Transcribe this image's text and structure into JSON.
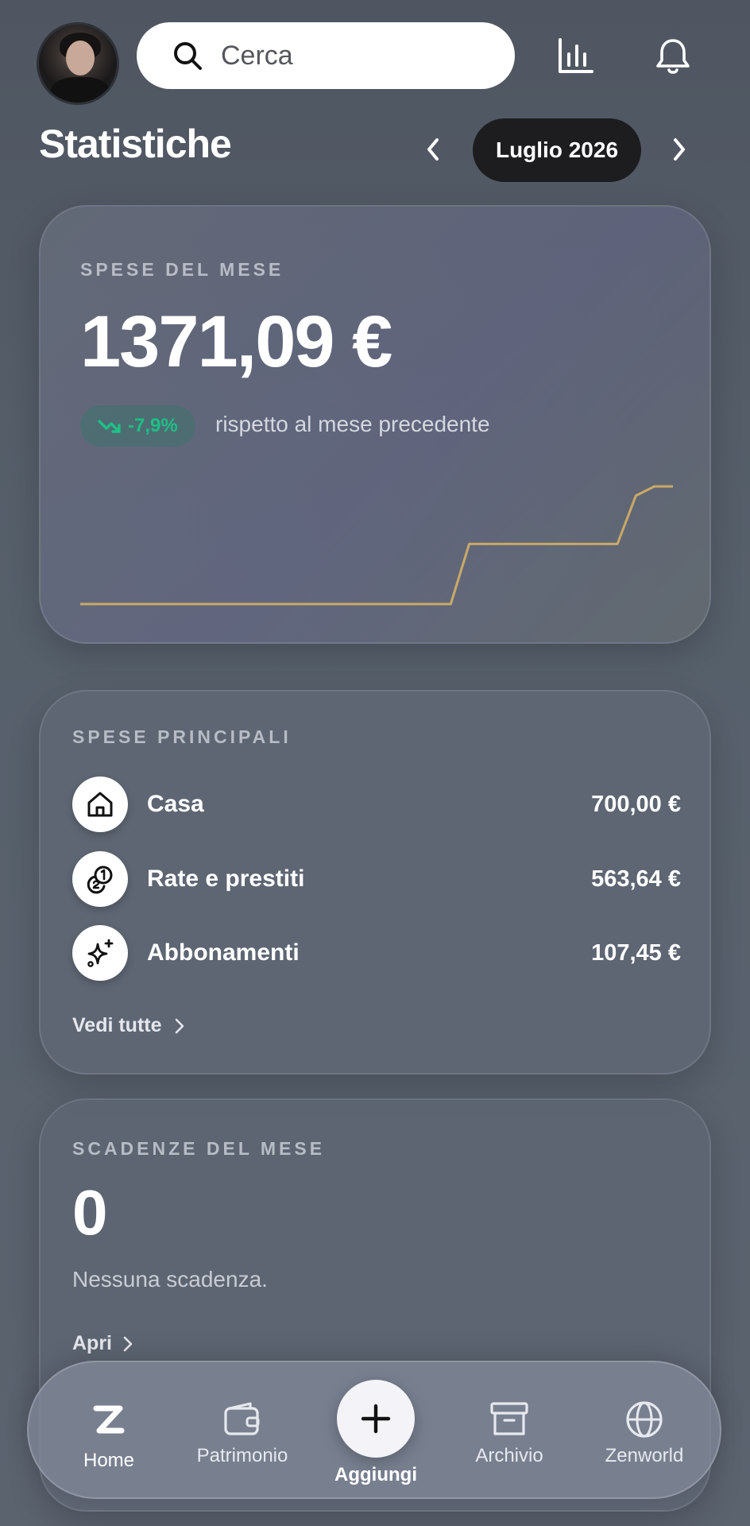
{
  "header": {
    "search_placeholder": "Cerca",
    "avatar": "profile-photo",
    "icons": [
      "search-icon",
      "bar-chart-icon",
      "bell-icon"
    ]
  },
  "title_row": {
    "title": "Statistiche",
    "month": "Luglio 2026"
  },
  "monthly_spend": {
    "eyebrow": "SPESE DEL MESE",
    "amount": "1371,09 €",
    "delta": "-7,9%",
    "delta_text": "rispetto al mese precedente",
    "colors": {
      "delta": "#1fbf86",
      "line": "#c9a968"
    }
  },
  "chart_data": {
    "type": "line",
    "title": "",
    "xlabel": "",
    "ylabel": "",
    "grid": false,
    "series": [
      {
        "values": [
          0,
          0,
          0,
          0,
          0,
          0,
          0,
          0,
          0,
          0,
          0,
          0,
          0,
          0,
          0,
          0,
          0,
          0,
          0,
          0,
          0,
          700,
          700,
          700,
          700,
          700,
          700,
          700,
          700,
          700,
          1263.64,
          1371.09,
          1371.09
        ]
      }
    ],
    "ylim": [
      0,
      1371.09
    ]
  },
  "top_expenses": {
    "eyebrow": "SPESE PRINCIPALI",
    "items": [
      {
        "label": "Casa",
        "amount": "700,00 €",
        "icon": "home-icon"
      },
      {
        "label": "Rate e prestiti",
        "amount": "563,64 €",
        "icon": "coins-icon"
      },
      {
        "label": "Abbonamenti",
        "amount": "107,45 €",
        "icon": "sparkles-icon"
      }
    ],
    "see_all": "Vedi tutte"
  },
  "deadlines": {
    "eyebrow": "SCADENZE DEL MESE",
    "count": "0",
    "empty_text": "Nessuna scadenza.",
    "open": "Apri"
  },
  "bottom_nav": {
    "home": "Home",
    "assets": "Patrimonio",
    "add": "Aggiungi",
    "archive": "Archivio",
    "zenworld": "Zenworld"
  }
}
